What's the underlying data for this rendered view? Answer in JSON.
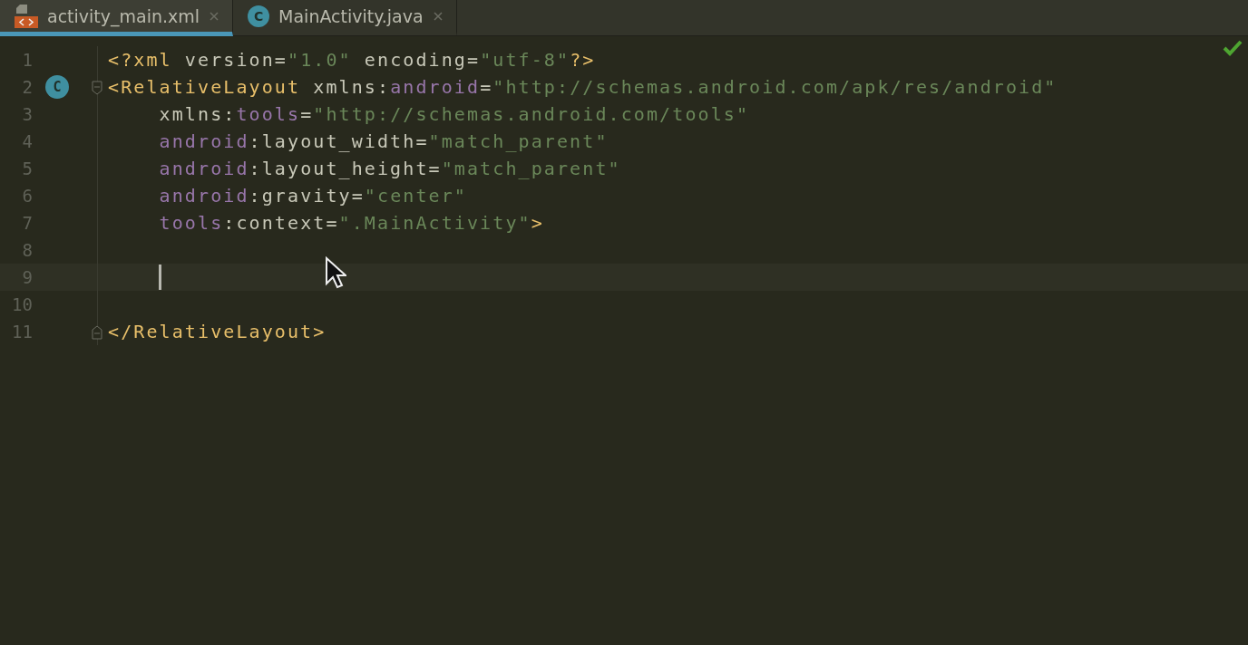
{
  "tabs": [
    {
      "label": "activity_main.xml",
      "kind": "xml",
      "selected": true
    },
    {
      "label": "MainActivity.java",
      "kind": "class",
      "icon_letter": "C",
      "selected": false
    }
  ],
  "editor": {
    "lines": [
      {
        "number": "1",
        "tokens": [
          {
            "kind": "tag",
            "text": "<?xml "
          },
          {
            "kind": "plain",
            "text": "version="
          },
          {
            "kind": "string",
            "text": "\"1.0\""
          },
          {
            "kind": "plain",
            "text": " encoding="
          },
          {
            "kind": "string",
            "text": "\"utf-8\""
          },
          {
            "kind": "tag",
            "text": "?>"
          }
        ]
      },
      {
        "number": "2",
        "gutter_badge": "C",
        "fold_start": true,
        "tokens": [
          {
            "kind": "tag",
            "text": "<RelativeLayout "
          },
          {
            "kind": "plain",
            "text": "xmlns:"
          },
          {
            "kind": "namespace",
            "text": "android"
          },
          {
            "kind": "plain",
            "text": "="
          },
          {
            "kind": "string",
            "text": "\"http://schemas.android.com/apk/res/android\""
          }
        ]
      },
      {
        "number": "3",
        "tokens": [
          {
            "kind": "plain",
            "text": "    xmlns:"
          },
          {
            "kind": "namespace",
            "text": "tools"
          },
          {
            "kind": "plain",
            "text": "="
          },
          {
            "kind": "string",
            "text": "\"http://schemas.android.com/tools\""
          }
        ]
      },
      {
        "number": "4",
        "tokens": [
          {
            "kind": "namespace",
            "text": "    android"
          },
          {
            "kind": "plain",
            "text": ":layout_width="
          },
          {
            "kind": "string",
            "text": "\"match_parent\""
          }
        ]
      },
      {
        "number": "5",
        "tokens": [
          {
            "kind": "namespace",
            "text": "    android"
          },
          {
            "kind": "plain",
            "text": ":layout_height="
          },
          {
            "kind": "string",
            "text": "\"match_parent\""
          }
        ]
      },
      {
        "number": "6",
        "tokens": [
          {
            "kind": "namespace",
            "text": "    android"
          },
          {
            "kind": "plain",
            "text": ":gravity="
          },
          {
            "kind": "string",
            "text": "\"center\""
          }
        ]
      },
      {
        "number": "7",
        "tokens": [
          {
            "kind": "namespace",
            "text": "    tools"
          },
          {
            "kind": "plain",
            "text": ":context="
          },
          {
            "kind": "string",
            "text": "\".MainActivity\""
          },
          {
            "kind": "tag",
            "text": ">"
          }
        ]
      },
      {
        "number": "8"
      },
      {
        "number": "9",
        "current": true
      },
      {
        "number": "10"
      },
      {
        "number": "11",
        "fold_end": true,
        "tokens": [
          {
            "kind": "tag",
            "text": "</RelativeLayout>"
          }
        ]
      }
    ]
  }
}
